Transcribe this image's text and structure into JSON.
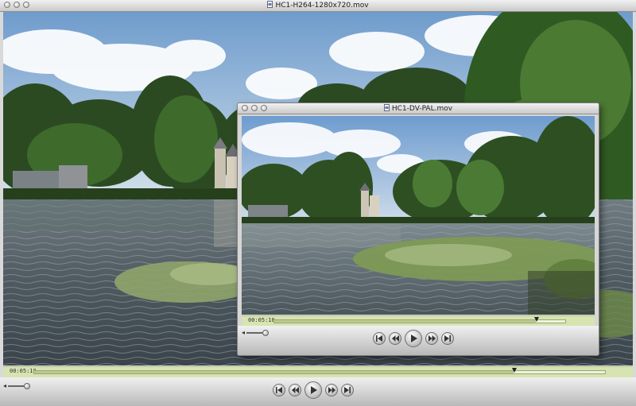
{
  "main_window": {
    "title": "HC1-H264-1280x720.mov",
    "timecode": "00:05:10",
    "progress": 0.84,
    "volume": 0.55
  },
  "pal_window": {
    "title": "HC1-DV-PAL.mov",
    "timecode": "00:05:10",
    "progress": 0.9,
    "volume": 0.55
  },
  "icons": {
    "window_buttons": [
      "close-icon",
      "minimize-icon",
      "zoom-icon"
    ],
    "transport": [
      "skip-back-icon",
      "rewind-icon",
      "play-icon",
      "fast-forward-icon",
      "skip-forward-icon"
    ],
    "volume": "speaker-icon",
    "file": "movie-file-icon"
  },
  "colors": {
    "scrub_bar": "#d8e3b2",
    "chrome": "#d9d9d9"
  }
}
